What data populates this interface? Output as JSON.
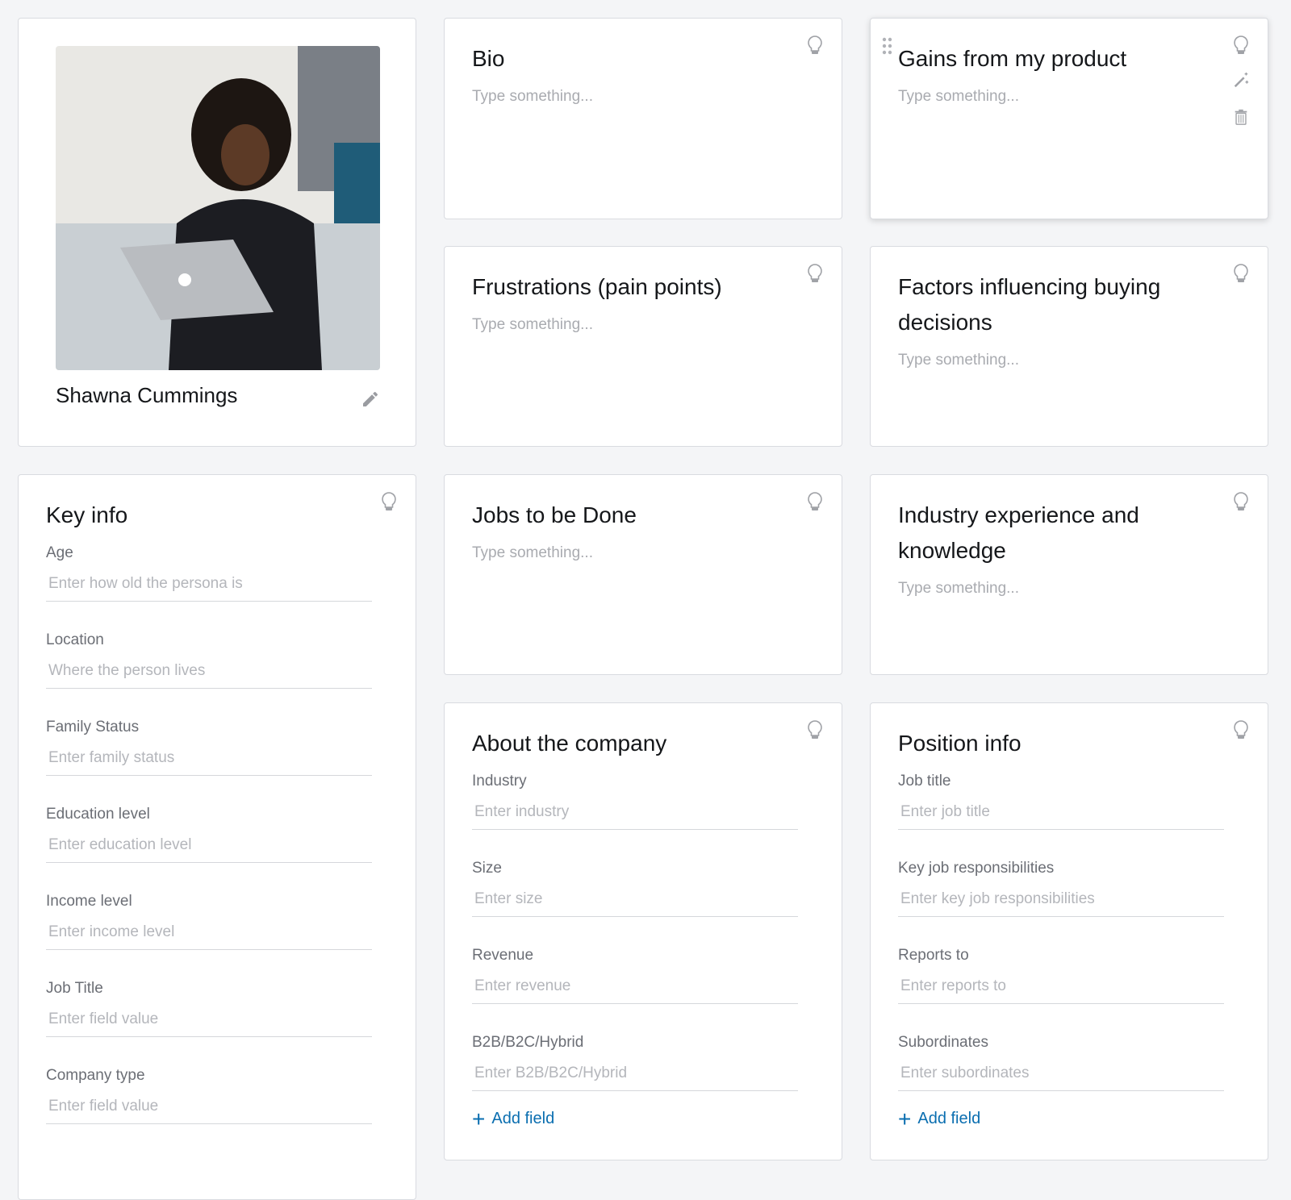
{
  "profile": {
    "name": "Shawna Cummings",
    "photo_alt": "persona-photo"
  },
  "placeholder": "Type something...",
  "cards": {
    "bio": {
      "title": "Bio"
    },
    "gains": {
      "title": "Gains from my product"
    },
    "frustrations": {
      "title": "Frustrations (pain points)"
    },
    "factors": {
      "title": "Factors influencing buying decisions"
    },
    "jobs": {
      "title": "Jobs to be Done"
    },
    "industry_exp": {
      "title": "Industry experience and knowledge"
    }
  },
  "key_info": {
    "title": "Key info",
    "fields": [
      {
        "label": "Age",
        "placeholder": "Enter how old the persona is"
      },
      {
        "label": "Location",
        "placeholder": "Where the person lives"
      },
      {
        "label": "Family Status",
        "placeholder": "Enter family status"
      },
      {
        "label": "Education level",
        "placeholder": "Enter education level"
      },
      {
        "label": "Income level",
        "placeholder": "Enter income level"
      },
      {
        "label": "Job Title",
        "placeholder": "Enter field value"
      },
      {
        "label": "Company type",
        "placeholder": "Enter field value"
      }
    ]
  },
  "company": {
    "title": "About the company",
    "fields": [
      {
        "label": "Industry",
        "placeholder": "Enter industry"
      },
      {
        "label": "Size",
        "placeholder": "Enter size"
      },
      {
        "label": "Revenue",
        "placeholder": "Enter revenue"
      },
      {
        "label": "B2B/B2C/Hybrid",
        "placeholder": "Enter B2B/B2C/Hybrid"
      }
    ],
    "add_label": "Add field"
  },
  "position": {
    "title": "Position info",
    "fields": [
      {
        "label": "Job title",
        "placeholder": "Enter job title"
      },
      {
        "label": "Key job responsibilities",
        "placeholder": "Enter key job responsibilities"
      },
      {
        "label": "Reports to",
        "placeholder": "Enter reports to"
      },
      {
        "label": "Subordinates",
        "placeholder": "Enter subordinates"
      }
    ],
    "add_label": "Add field"
  },
  "colors": {
    "accent": "#0a6eb0",
    "background": "#f4f5f7"
  }
}
